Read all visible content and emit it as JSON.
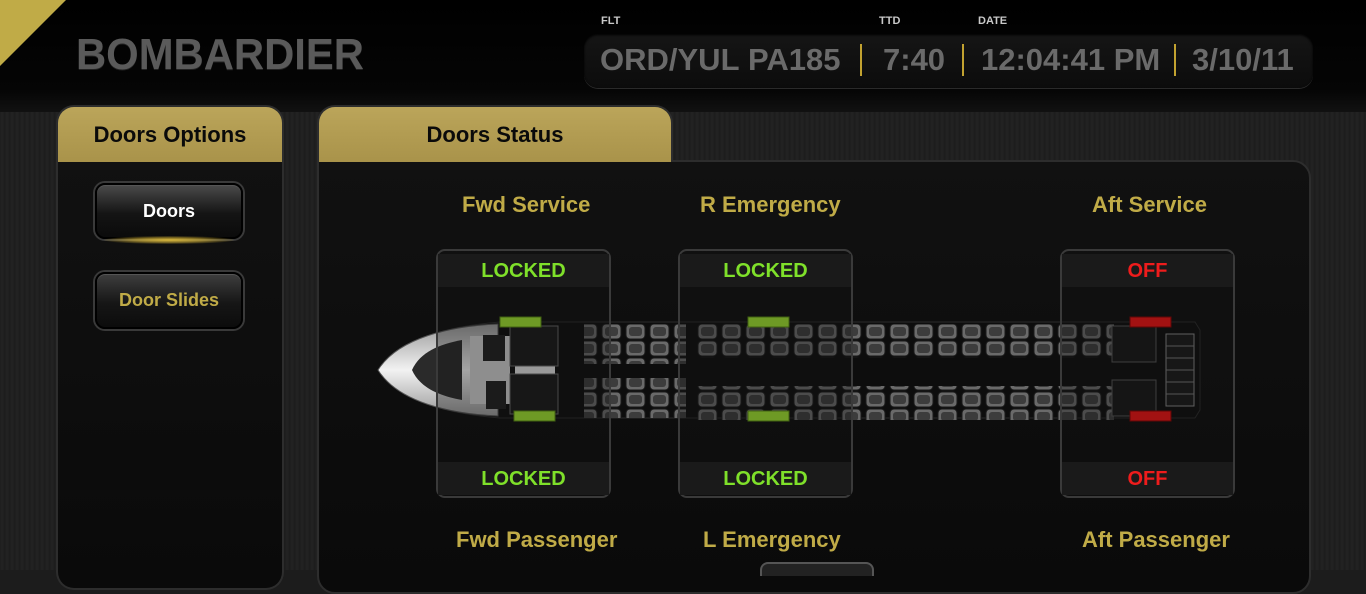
{
  "brand": "BOMBARDIER",
  "flight": {
    "flt_caption": "FLT",
    "route": "ORD/YUL",
    "flight_number": "PA185",
    "ttd_caption": "TTD",
    "ttd": "7:40",
    "date_caption": "DATE",
    "time": "12:04:41 PM",
    "date": "3/10/11"
  },
  "options_panel": {
    "title": "Doors Options",
    "buttons": [
      {
        "label": "Doors",
        "active": true
      },
      {
        "label": "Door Slides",
        "active": false
      }
    ]
  },
  "status_panel": {
    "title": "Doors Status",
    "doors": {
      "fwd_service": {
        "label": "Fwd Service",
        "status": "LOCKED"
      },
      "fwd_passenger": {
        "label": "Fwd Passenger",
        "status": "LOCKED"
      },
      "r_emergency": {
        "label": "R Emergency",
        "status": "LOCKED"
      },
      "l_emergency": {
        "label": "L Emergency",
        "status": "LOCKED"
      },
      "aft_service": {
        "label": "Aft Service",
        "status": "OFF"
      },
      "aft_passenger": {
        "label": "Aft Passenger",
        "status": "OFF"
      }
    }
  },
  "colors": {
    "accent_gold": "#c0ab47",
    "locked_green": "#7fe02a",
    "off_red": "#ee1c1c"
  }
}
